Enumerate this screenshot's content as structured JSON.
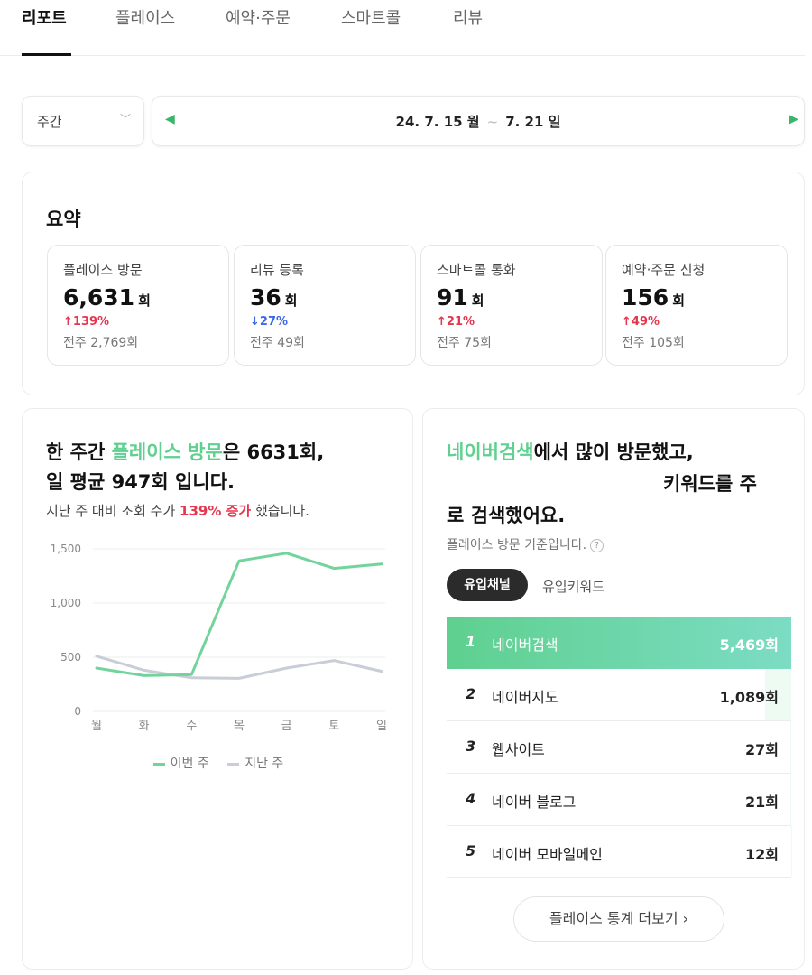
{
  "tabs": [
    "리포트",
    "플레이스",
    "예약·주문",
    "스마트콜",
    "리뷰"
  ],
  "period": {
    "selected": "주간",
    "range_start": "24. 7. 15 월",
    "range_sep": "~",
    "range_end": "7. 21 일"
  },
  "summary": {
    "title": "요약",
    "stats": [
      {
        "label": "플레이스 방문",
        "value": "6,631",
        "unit": "회",
        "change": "139%",
        "direction": "up",
        "prev": "전주 2,769회"
      },
      {
        "label": "리뷰 등록",
        "value": "36",
        "unit": "회",
        "change": "27%",
        "direction": "down",
        "prev": "전주 49회"
      },
      {
        "label": "스마트콜 통화",
        "value": "91",
        "unit": "회",
        "change": "21%",
        "direction": "up",
        "prev": "전주 75회"
      },
      {
        "label": "예약·주문 신청",
        "value": "156",
        "unit": "회",
        "change": "49%",
        "direction": "up",
        "prev": "전주 105회"
      }
    ]
  },
  "visits": {
    "headline_a": "한 주간 ",
    "headline_b": "플레이스 방문",
    "headline_c": "은 6631회,",
    "headline_d": "일 평균 947회 입니다.",
    "sub_a": "지난 주 대비 조회 수가 ",
    "sub_b": "139% 증가",
    "sub_c": " 했습니다."
  },
  "chart_data": {
    "type": "line",
    "x": [
      "월",
      "화",
      "수",
      "목",
      "금",
      "토",
      "일"
    ],
    "ylim": [
      0,
      1500
    ],
    "yticks": [
      "1,500",
      "1,000",
      "500",
      "0"
    ],
    "series": [
      {
        "name": "이번 주",
        "color": "#72d49b",
        "values": [
          400,
          330,
          340,
          1390,
          1460,
          1320,
          1360
        ]
      },
      {
        "name": "지난 주",
        "color": "#c9cdd8",
        "values": [
          510,
          380,
          310,
          305,
          400,
          470,
          370
        ]
      }
    ]
  },
  "channels": {
    "h1_a": "네이버검색",
    "h1_b": "에서 많이 방문했고,",
    "h2": "키워드를 주",
    "h3": "로 검색했어요.",
    "basis": "플레이스 방문 기준입니다.",
    "basis_q": "?",
    "tab_active": "유입채널",
    "tab_other": "유입키워드",
    "rows": [
      {
        "rank": "1",
        "name": "네이버검색",
        "count": "5,469회",
        "share": 1.0
      },
      {
        "rank": "2",
        "name": "네이버지도",
        "count": "1,089회",
        "share": 0.2
      },
      {
        "rank": "3",
        "name": "웹사이트",
        "count": "27회",
        "share": 0.005
      },
      {
        "rank": "4",
        "name": "네이버 블로그",
        "count": "21회",
        "share": 0.004
      },
      {
        "rank": "5",
        "name": "네이버 모바일메인",
        "count": "12회",
        "share": 0.002
      }
    ],
    "more": "플레이스 통계 더보기 ›"
  },
  "colors": {
    "accent": "#5fd08f",
    "up": "#e5364f",
    "down": "#3f68e8"
  }
}
